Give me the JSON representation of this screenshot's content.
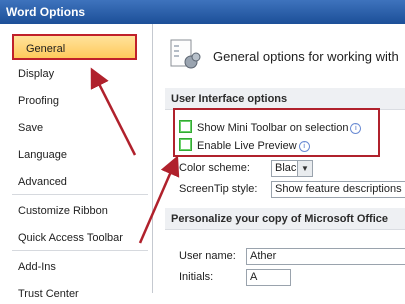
{
  "window": {
    "title": "Word Options"
  },
  "sidebar": {
    "items": [
      {
        "label": "General",
        "selected": true
      },
      {
        "label": "Display"
      },
      {
        "label": "Proofing"
      },
      {
        "label": "Save"
      },
      {
        "label": "Language"
      },
      {
        "label": "Advanced"
      },
      {
        "label": "Customize Ribbon"
      },
      {
        "label": "Quick Access Toolbar"
      },
      {
        "label": "Add-Ins"
      },
      {
        "label": "Trust Center"
      }
    ]
  },
  "main": {
    "header": "General options for working with",
    "ui_section": {
      "title": "User Interface options",
      "show_mini_toolbar": "Show Mini Toolbar on selection",
      "enable_live_preview": "Enable Live Preview",
      "color_scheme_label": "Color scheme:",
      "color_scheme_value": "Black",
      "screentip_label": "ScreenTip style:",
      "screentip_value": "Show feature descriptions"
    },
    "personalize_section": {
      "title": "Personalize your copy of Microsoft Office",
      "user_name_label": "User name:",
      "user_name_value": "Ather",
      "initials_label": "Initials:",
      "initials_value": "A"
    }
  },
  "colors": {
    "accent": "#c0202a",
    "selected_bg": "#ffd46e",
    "checkbox": "#33aa33"
  }
}
